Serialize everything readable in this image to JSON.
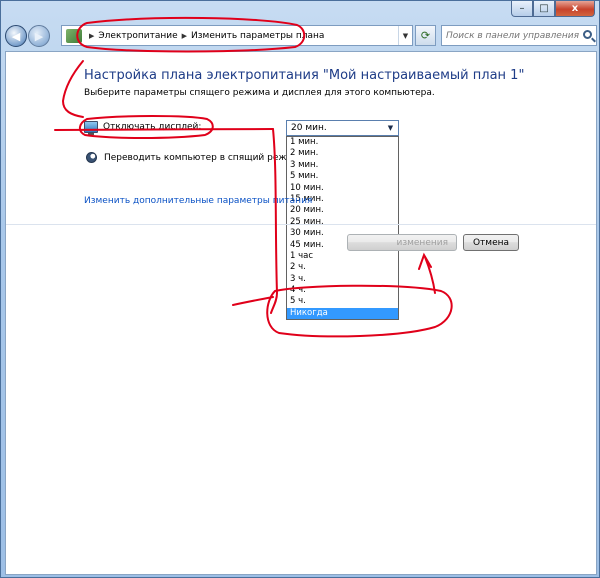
{
  "window": {
    "controls": {
      "minimize": "–",
      "maximize": "□",
      "close": "x"
    }
  },
  "nav": {
    "back_icon": "back-arrow-icon",
    "forward_icon": "forward-arrow-icon",
    "dropdown_icon": "chevron-down-icon",
    "refresh_icon": "refresh-icon"
  },
  "address": {
    "breadcrumbs": [
      "Электропитание",
      "Изменить параметры плана"
    ]
  },
  "search": {
    "placeholder": "Поиск в панели управления"
  },
  "content": {
    "title": "Настройка плана электропитания \"Мой настраиваемый план 1\"",
    "subtitle": "Выберите параметры спящего режима и дисплея для этого компьютера.",
    "display_label": "Отключать дисплей:",
    "sleep_label": "Переводить компьютер в спящий режим:",
    "display_selected": "20 мин.",
    "dropdown_options": [
      "1 мин.",
      "2 мин.",
      "3 мин.",
      "5 мин.",
      "10 мин.",
      "15 мин.",
      "20 мин.",
      "25 мин.",
      "30 мин.",
      "45 мин.",
      "1 час",
      "2 ч.",
      "3 ч.",
      "4 ч.",
      "5 ч.",
      "Никогда"
    ],
    "highlighted_option": "Никогда",
    "advanced_link": "Изменить дополнительные параметры питания",
    "save_button": "изменения",
    "cancel_button": "Отмена"
  },
  "colors": {
    "title": "#1e3c87",
    "link": "#0b52c5",
    "selection": "#3399ff",
    "annotation": "#e0001a"
  }
}
